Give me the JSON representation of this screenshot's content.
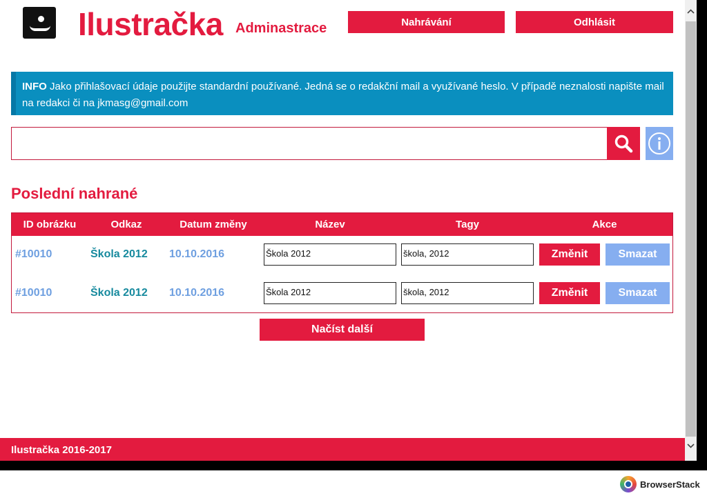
{
  "header": {
    "brand": "Ilustračka",
    "subtitle": "Adminastrace",
    "upload_label": "Nahrávání",
    "logout_label": "Odhlásit"
  },
  "info": {
    "label": "INFO",
    "text": "Jako přihlašovací údaje použijte standardní používané. Jedná se o redakční mail a využívané heslo. V případě neznalosti napište mail na redakci či na jkmasg@gmail.com"
  },
  "search": {
    "value": "",
    "search_icon": "search-icon",
    "info_icon": "info-icon"
  },
  "recent": {
    "title": "Poslední nahrané",
    "columns": [
      "ID obrázku",
      "Odkaz",
      "Datum změny",
      "Název",
      "Tagy",
      "Akce"
    ],
    "rows": [
      {
        "id": "#10010",
        "link": "Škola 2012",
        "date": "10.10.2016",
        "name": "Škola 2012",
        "tags": "škola, 2012",
        "change": "Změnit",
        "delete": "Smazat"
      },
      {
        "id": "#10010",
        "link": "Škola 2012",
        "date": "10.10.2016",
        "name": "Škola 2012",
        "tags": "škola, 2012",
        "change": "Změnit",
        "delete": "Smazat"
      }
    ],
    "load_more": "Načíst další"
  },
  "footer": {
    "text": "Ilustračka 2016-2017"
  },
  "browserstack": {
    "label": "BrowserStack"
  },
  "colors": {
    "accent": "#e31b3f",
    "info": "#0a8fbf",
    "light_blue": "#86aef0",
    "teal": "#178a9e"
  }
}
